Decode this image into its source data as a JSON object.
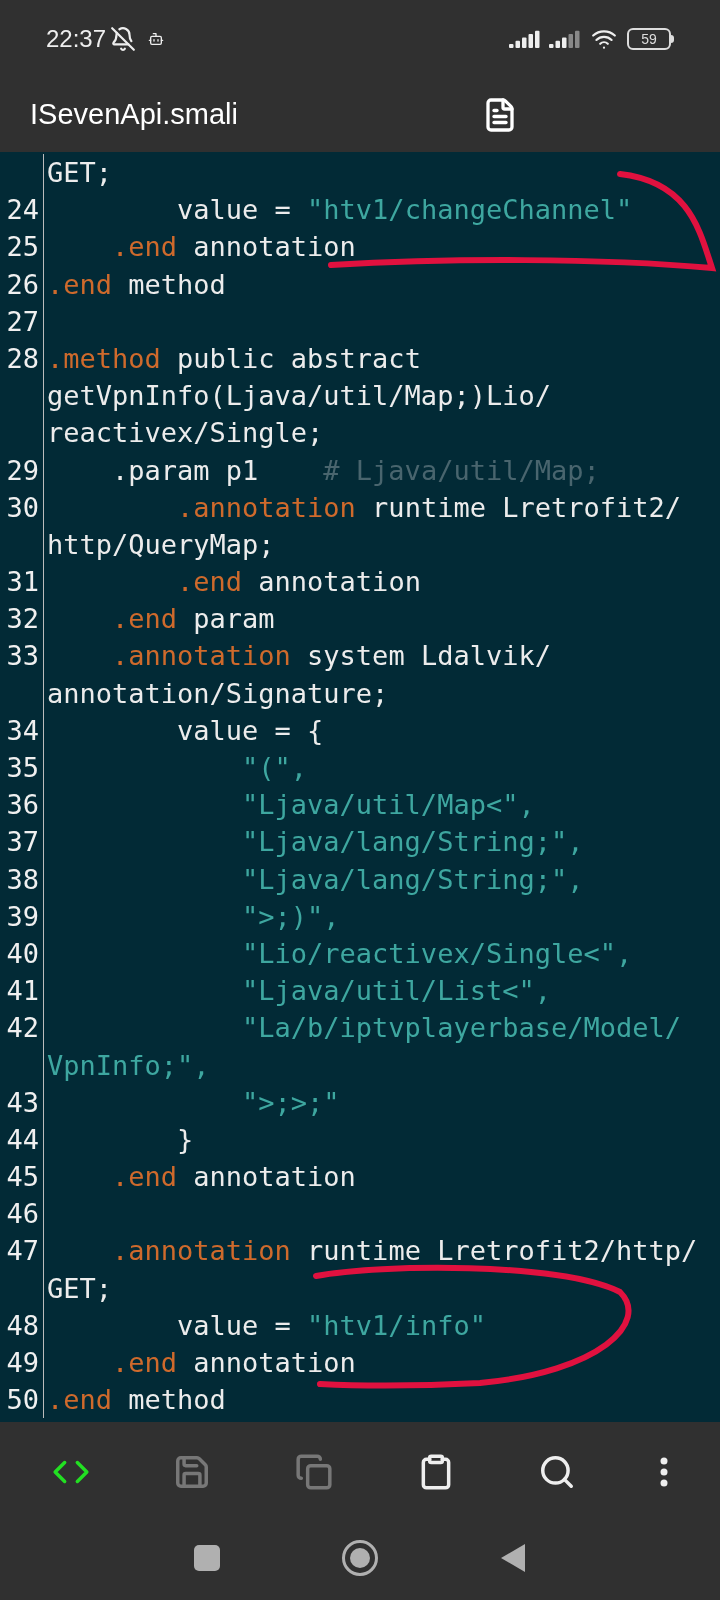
{
  "status_bar": {
    "time": "22:37",
    "battery": "59"
  },
  "title_bar": {
    "title": "ISevenApi.smali"
  },
  "editor": {
    "lines": [
      {
        "segments": [
          {
            "kind": "plain",
            "text": "GET;"
          }
        ]
      },
      {
        "number": "24",
        "segments": [
          {
            "kind": "plain",
            "text": "        value = "
          },
          {
            "kind": "string",
            "text": "\"htv1/changeChannel\""
          }
        ]
      },
      {
        "number": "25",
        "segments": [
          {
            "kind": "keyword",
            "text": "    .end"
          },
          {
            "kind": "plain",
            "text": " annotation"
          }
        ]
      },
      {
        "number": "26",
        "segments": [
          {
            "kind": "keyword",
            "text": ".end"
          },
          {
            "kind": "plain",
            "text": " method"
          }
        ]
      },
      {
        "number": "27"
      },
      {
        "number": "28",
        "segments": [
          {
            "kind": "keyword",
            "text": ".method"
          },
          {
            "kind": "plain",
            "text": " public abstract"
          }
        ]
      },
      {
        "segments": [
          {
            "kind": "plain",
            "text": "getVpnInfo(Ljava/util/Map;)Lio/"
          }
        ]
      },
      {
        "segments": [
          {
            "kind": "plain",
            "text": "reactivex/Single;"
          }
        ]
      },
      {
        "number": "29",
        "segments": [
          {
            "kind": "plain",
            "text": "    .param p1    "
          },
          {
            "kind": "comment",
            "text": "# Ljava/util/Map;"
          }
        ]
      },
      {
        "number": "30",
        "segments": [
          {
            "kind": "keyword",
            "text": "        .annotation"
          },
          {
            "kind": "plain",
            "text": " runtime Lretrofit2/"
          }
        ]
      },
      {
        "segments": [
          {
            "kind": "plain",
            "text": "http/QueryMap;"
          }
        ]
      },
      {
        "number": "31",
        "segments": [
          {
            "kind": "keyword",
            "text": "        .end"
          },
          {
            "kind": "plain",
            "text": " annotation"
          }
        ]
      },
      {
        "number": "32",
        "segments": [
          {
            "kind": "keyword",
            "text": "    .end"
          },
          {
            "kind": "plain",
            "text": " param"
          }
        ]
      },
      {
        "number": "33",
        "segments": [
          {
            "kind": "keyword",
            "text": "    .annotation"
          },
          {
            "kind": "plain",
            "text": " system Ldalvik/"
          }
        ]
      },
      {
        "segments": [
          {
            "kind": "plain",
            "text": "annotation/Signature;"
          }
        ]
      },
      {
        "number": "34",
        "segments": [
          {
            "kind": "plain",
            "text": "        value = {"
          }
        ]
      },
      {
        "number": "35",
        "segments": [
          {
            "kind": "string",
            "text": "            \"(\","
          }
        ]
      },
      {
        "number": "36",
        "segments": [
          {
            "kind": "string",
            "text": "            \"Ljava/util/Map<\","
          }
        ]
      },
      {
        "number": "37",
        "segments": [
          {
            "kind": "string",
            "text": "            \"Ljava/lang/String;\","
          }
        ]
      },
      {
        "number": "38",
        "segments": [
          {
            "kind": "string",
            "text": "            \"Ljava/lang/String;\","
          }
        ]
      },
      {
        "number": "39",
        "segments": [
          {
            "kind": "string",
            "text": "            \">;)\","
          }
        ]
      },
      {
        "number": "40",
        "segments": [
          {
            "kind": "string",
            "text": "            \"Lio/reactivex/Single<\","
          }
        ]
      },
      {
        "number": "41",
        "segments": [
          {
            "kind": "string",
            "text": "            \"Ljava/util/List<\","
          }
        ]
      },
      {
        "number": "42",
        "segments": [
          {
            "kind": "string",
            "text": "            \"La/b/iptvplayerbase/Model/"
          }
        ]
      },
      {
        "segments": [
          {
            "kind": "string",
            "text": "VpnInfo;\","
          }
        ]
      },
      {
        "number": "43",
        "segments": [
          {
            "kind": "string",
            "text": "            \">;>;\""
          }
        ]
      },
      {
        "number": "44",
        "segments": [
          {
            "kind": "plain",
            "text": "        }"
          }
        ]
      },
      {
        "number": "45",
        "segments": [
          {
            "kind": "keyword",
            "text": "    .end"
          },
          {
            "kind": "plain",
            "text": " annotation"
          }
        ]
      },
      {
        "number": "46"
      },
      {
        "number": "47",
        "segments": [
          {
            "kind": "keyword",
            "text": "    .annotation"
          },
          {
            "kind": "plain",
            "text": " runtime Lretrofit2/http/"
          }
        ]
      },
      {
        "segments": [
          {
            "kind": "plain",
            "text": "GET;"
          }
        ]
      },
      {
        "number": "48",
        "segments": [
          {
            "kind": "plain",
            "text": "        value = "
          },
          {
            "kind": "string",
            "text": "\"htv1/info\""
          }
        ]
      },
      {
        "number": "49",
        "segments": [
          {
            "kind": "keyword",
            "text": "    .end"
          },
          {
            "kind": "plain",
            "text": " annotation"
          }
        ]
      },
      {
        "number": "50",
        "segments": [
          {
            "kind": "keyword",
            "text": ".end"
          },
          {
            "kind": "plain",
            "text": " method"
          }
        ]
      }
    ]
  },
  "toolbar": [
    {
      "kind": "code",
      "selected": true,
      "disabled": false
    },
    {
      "kind": "save",
      "selected": false,
      "disabled": true
    },
    {
      "kind": "copy",
      "selected": false,
      "disabled": true
    },
    {
      "kind": "paste",
      "selected": false,
      "disabled": false
    },
    {
      "kind": "search",
      "selected": false,
      "disabled": false
    },
    {
      "kind": "more",
      "selected": false,
      "disabled": false
    }
  ]
}
